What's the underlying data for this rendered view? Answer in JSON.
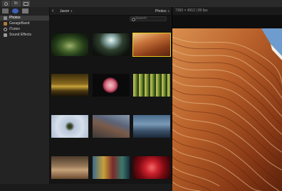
{
  "toolbar": {
    "button1_icon": "import-icon",
    "button2_label": "lib",
    "button3_icon": "window-icon"
  },
  "sidebar": {
    "tabs": [
      {
        "icon": "photos-tab-icon"
      },
      {
        "icon": "music-tab-icon"
      },
      {
        "icon": "titles-tab-icon"
      }
    ],
    "items": [
      {
        "label": "Photos",
        "icon": "photos-icon",
        "selected": true
      },
      {
        "label": "GarageBand",
        "icon": "guitar-icon",
        "selected": false
      },
      {
        "label": "iTunes",
        "icon": "music-note-icon",
        "selected": false
      },
      {
        "label": "Sound Effects",
        "icon": "speaker-icon",
        "selected": false
      }
    ]
  },
  "browser": {
    "album_label": "Jason",
    "source_label": "Photos",
    "search_placeholder": "Search",
    "thumbnails": [
      {
        "name": "abstract-swirl",
        "selected": false
      },
      {
        "name": "concert-stage",
        "selected": false
      },
      {
        "name": "canyon-sandstone",
        "selected": true
      },
      {
        "name": "stadium-dusk",
        "selected": false
      },
      {
        "name": "pink-flower",
        "selected": false
      },
      {
        "name": "bamboo-forest",
        "selected": false
      },
      {
        "name": "tiny-planet",
        "selected": false
      },
      {
        "name": "freeway-traffic",
        "selected": false
      },
      {
        "name": "city-street",
        "selected": false
      },
      {
        "name": "hazy-skyline",
        "selected": false
      },
      {
        "name": "neon-street",
        "selected": false
      },
      {
        "name": "red-blossom",
        "selected": false
      }
    ]
  },
  "viewer": {
    "info": "7360 × 4912 | 80 fps"
  },
  "colors": {
    "selection_outline": "#e6c81a",
    "sidebar_selected": "#3a3a3a"
  }
}
